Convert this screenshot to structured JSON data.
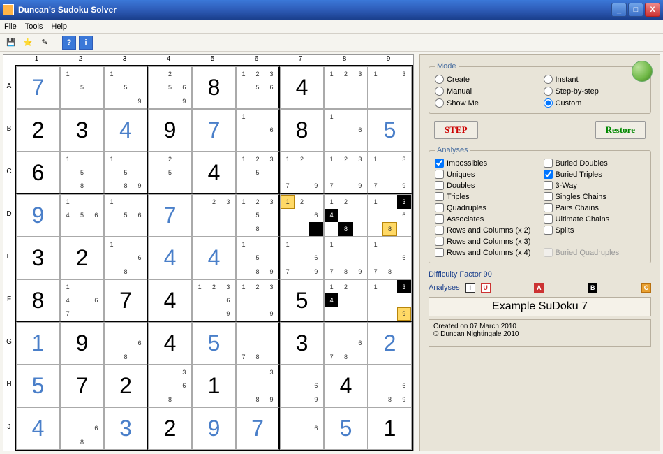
{
  "window": {
    "title": "Duncan's Sudoku Solver"
  },
  "menu": {
    "file": "File",
    "tools": "Tools",
    "help": "Help"
  },
  "toolbar": {
    "save": "💾",
    "star": "⭐",
    "new": "✎",
    "q": "?",
    "i": "i"
  },
  "grid": {
    "cols": [
      "1",
      "2",
      "3",
      "4",
      "5",
      "6",
      "7",
      "8",
      "9"
    ],
    "rows": [
      "A",
      "B",
      "C",
      "D",
      "E",
      "F",
      "G",
      "H",
      "J"
    ],
    "cells": [
      [
        {
          "v": "7",
          "c": "blue"
        },
        {
          "p": [
            "1",
            "",
            "",
            "",
            "5",
            "",
            "",
            "",
            ""
          ]
        },
        {
          "p": [
            "1",
            "",
            "",
            "",
            "5",
            "",
            "",
            "",
            "9"
          ]
        },
        {
          "p": [
            "",
            "2",
            "",
            "",
            "5",
            "6",
            "",
            "",
            "9"
          ]
        },
        {
          "v": "8",
          "c": "black"
        },
        {
          "p": [
            "1",
            "2",
            "3",
            "",
            "5",
            "6",
            "",
            "",
            ""
          ]
        },
        {
          "v": "4",
          "c": "black"
        },
        {
          "p": [
            "1",
            "2",
            "3",
            "",
            "",
            "",
            "",
            "",
            ""
          ]
        },
        {
          "p": [
            "1",
            "",
            "3",
            "",
            "",
            "",
            "",
            "",
            ""
          ]
        }
      ],
      [
        {
          "v": "2",
          "c": "black"
        },
        {
          "v": "3",
          "c": "black"
        },
        {
          "v": "4",
          "c": "blue"
        },
        {
          "v": "9",
          "c": "black"
        },
        {
          "v": "7",
          "c": "blue"
        },
        {
          "p": [
            "1",
            "",
            "",
            "",
            "",
            "6",
            "",
            "",
            ""
          ]
        },
        {
          "v": "8",
          "c": "black"
        },
        {
          "p": [
            "1",
            "",
            "",
            "",
            "",
            "6",
            "",
            "",
            ""
          ]
        },
        {
          "v": "5",
          "c": "blue"
        }
      ],
      [
        {
          "v": "6",
          "c": "black"
        },
        {
          "p": [
            "1",
            "",
            "",
            "",
            "5",
            "",
            "",
            "8",
            ""
          ]
        },
        {
          "p": [
            "1",
            "",
            "",
            "",
            "5",
            "",
            "",
            "8",
            "9"
          ]
        },
        {
          "p": [
            "",
            "2",
            "",
            "",
            "5",
            "",
            "",
            "",
            ""
          ]
        },
        {
          "v": "4",
          "c": "black"
        },
        {
          "p": [
            "1",
            "2",
            "3",
            "",
            "5",
            "",
            "",
            "",
            ""
          ]
        },
        {
          "p": [
            "1",
            "2",
            "",
            "",
            "",
            "",
            "7",
            "",
            "9"
          ]
        },
        {
          "p": [
            "1",
            "2",
            "3",
            "",
            "",
            "",
            "7",
            "",
            "9"
          ]
        },
        {
          "p": [
            "1",
            "",
            "3",
            "",
            "",
            "",
            "7",
            "",
            "9"
          ]
        }
      ],
      [
        {
          "v": "9",
          "c": "blue"
        },
        {
          "p": [
            "1",
            "",
            "",
            "4",
            "5",
            "6",
            "",
            "",
            ""
          ]
        },
        {
          "p": [
            "1",
            "",
            "",
            "",
            "5",
            "6",
            "",
            "",
            ""
          ]
        },
        {
          "v": "7",
          "c": "blue"
        },
        {
          "p": [
            "",
            "2",
            "3",
            "",
            "",
            "",
            "",
            "",
            ""
          ]
        },
        {
          "p": [
            "1",
            "2",
            "3",
            "",
            "5",
            "",
            "",
            "8",
            ""
          ]
        },
        {
          "p": [
            "1",
            "2",
            "",
            "",
            "",
            "6",
            "",
            "",
            ""
          ],
          "hl": {
            "0": "y",
            "8": "k"
          }
        },
        {
          "p": [
            "1",
            "2",
            "",
            "4",
            "",
            "",
            "",
            "8",
            ""
          ],
          "hl": {
            "3": "k",
            "7": "k"
          }
        },
        {
          "p": [
            "1",
            "",
            "3",
            "",
            "",
            "6",
            "",
            "8",
            ""
          ],
          "hl": {
            "2": "k",
            "7": "y"
          }
        }
      ],
      [
        {
          "v": "3",
          "c": "black"
        },
        {
          "v": "2",
          "c": "black"
        },
        {
          "p": [
            "1",
            "",
            "",
            "",
            "",
            "6",
            "",
            "8",
            ""
          ]
        },
        {
          "v": "4",
          "c": "blue"
        },
        {
          "v": "4",
          "c": "blue"
        },
        {
          "p": [
            "1",
            "",
            "",
            "",
            "5",
            "",
            "",
            "8",
            "9"
          ]
        },
        {
          "p": [
            "1",
            "",
            "",
            "",
            "",
            "6",
            "7",
            "",
            "9"
          ]
        },
        {
          "p": [
            "1",
            "",
            "",
            "",
            "",
            "",
            "7",
            "8",
            "9"
          ]
        },
        {
          "p": [
            "1",
            "",
            "",
            "",
            "",
            "6",
            "7",
            "8",
            ""
          ]
        }
      ],
      [
        {
          "v": "8",
          "c": "black"
        },
        {
          "p": [
            "1",
            "",
            "",
            "4",
            "",
            "6",
            "7",
            "",
            ""
          ]
        },
        {
          "v": "7",
          "c": "black"
        },
        {
          "v": "4",
          "c": "black"
        },
        {
          "p": [
            "1",
            "2",
            "3",
            "",
            "",
            "6",
            "",
            "",
            "9"
          ]
        },
        {
          "p": [
            "1",
            "2",
            "3",
            "",
            "",
            "",
            "",
            "",
            "9"
          ]
        },
        {
          "v": "5",
          "c": "black"
        },
        {
          "p": [
            "1",
            "2",
            "",
            "4",
            "",
            "",
            "",
            "",
            ""
          ],
          "hl": {
            "3": "k"
          }
        },
        {
          "p": [
            "1",
            "",
            "3",
            "",
            "",
            "",
            "",
            "",
            "9"
          ],
          "hl": {
            "2": "k",
            "8": "y"
          }
        }
      ],
      [
        {
          "v": "1",
          "c": "blue"
        },
        {
          "v": "9",
          "c": "black"
        },
        {
          "p": [
            "",
            "",
            "",
            "",
            "",
            "6",
            "",
            "8",
            ""
          ]
        },
        {
          "v": "4",
          "c": "black"
        },
        {
          "v": "5",
          "c": "blue"
        },
        {
          "p": [
            "",
            "",
            "",
            "",
            "",
            "",
            "7",
            "8",
            ""
          ]
        },
        {
          "v": "3",
          "c": "black"
        },
        {
          "p": [
            "",
            "",
            "",
            "",
            "",
            "6",
            "7",
            "8",
            ""
          ]
        },
        {
          "v": "2",
          "c": "blue"
        }
      ],
      [
        {
          "v": "5",
          "c": "blue"
        },
        {
          "v": "7",
          "c": "black"
        },
        {
          "v": "2",
          "c": "black"
        },
        {
          "p": [
            "",
            "",
            "3",
            "",
            "",
            "6",
            "",
            "8",
            ""
          ]
        },
        {
          "v": "1",
          "c": "black"
        },
        {
          "p": [
            "",
            "",
            "3",
            "",
            "",
            "",
            "",
            "8",
            "9"
          ]
        },
        {
          "p": [
            "",
            "",
            "",
            "",
            "",
            "6",
            "",
            "",
            "9"
          ]
        },
        {
          "v": "4",
          "c": "black"
        },
        {
          "p": [
            "",
            "",
            "",
            "",
            "",
            "6",
            "",
            "8",
            "9"
          ]
        }
      ],
      [
        {
          "v": "4",
          "c": "blue"
        },
        {
          "p": [
            "",
            "",
            "",
            "",
            "",
            "6",
            "",
            "8",
            ""
          ]
        },
        {
          "v": "3",
          "c": "blue"
        },
        {
          "v": "2",
          "c": "black"
        },
        {
          "v": "9",
          "c": "blue"
        },
        {
          "v": "7",
          "c": "blue"
        },
        {
          "p": [
            "",
            "",
            "",
            "",
            "",
            "6",
            "",
            "",
            ""
          ]
        },
        {
          "v": "5",
          "c": "blue"
        },
        {
          "v": "1",
          "c": "black"
        }
      ]
    ]
  },
  "mode": {
    "legend": "Mode",
    "options": [
      {
        "label": "Create",
        "sel": false
      },
      {
        "label": "Instant",
        "sel": false
      },
      {
        "label": "Manual",
        "sel": false
      },
      {
        "label": "Step-by-step",
        "sel": false
      },
      {
        "label": "Show Me",
        "sel": false
      },
      {
        "label": "Custom",
        "sel": true
      }
    ]
  },
  "buttons": {
    "step": "STEP",
    "restore": "Restore"
  },
  "analyses": {
    "legend": "Analyses",
    "left": [
      {
        "label": "Impossibles",
        "chk": true
      },
      {
        "label": "Uniques",
        "chk": false
      },
      {
        "label": "Doubles",
        "chk": false
      },
      {
        "label": "Triples",
        "chk": false
      },
      {
        "label": "Quadruples",
        "chk": false
      },
      {
        "label": "Associates",
        "chk": false
      },
      {
        "label": "Rows and Columns (x 2)",
        "chk": false
      },
      {
        "label": "Rows and Columns (x 3)",
        "chk": false
      },
      {
        "label": "Rows and Columns (x 4)",
        "chk": false
      }
    ],
    "right": [
      {
        "label": "Buried Doubles",
        "chk": false
      },
      {
        "label": "Buried Triples",
        "chk": true
      },
      {
        "label": "3-Way",
        "chk": false
      },
      {
        "label": "Singles Chains",
        "chk": false
      },
      {
        "label": "Pairs Chains",
        "chk": false
      },
      {
        "label": "Ultimate Chains",
        "chk": false
      },
      {
        "label": "Splits",
        "chk": false
      },
      {
        "label": "",
        "chk": false,
        "blank": true
      },
      {
        "label": "Buried Quadruples",
        "chk": false,
        "dis": true
      }
    ]
  },
  "difficulty": {
    "label": "Difficulty Factor 90",
    "analyses_label": "Analyses"
  },
  "badges": {
    "i": "I",
    "u": "U",
    "a": "A",
    "b": "B",
    "c": "C"
  },
  "puzzle": {
    "name": "Example SuDoku 7",
    "created": "Created on 07 March 2010",
    "copyright": "© Duncan Nightingale 2010"
  }
}
